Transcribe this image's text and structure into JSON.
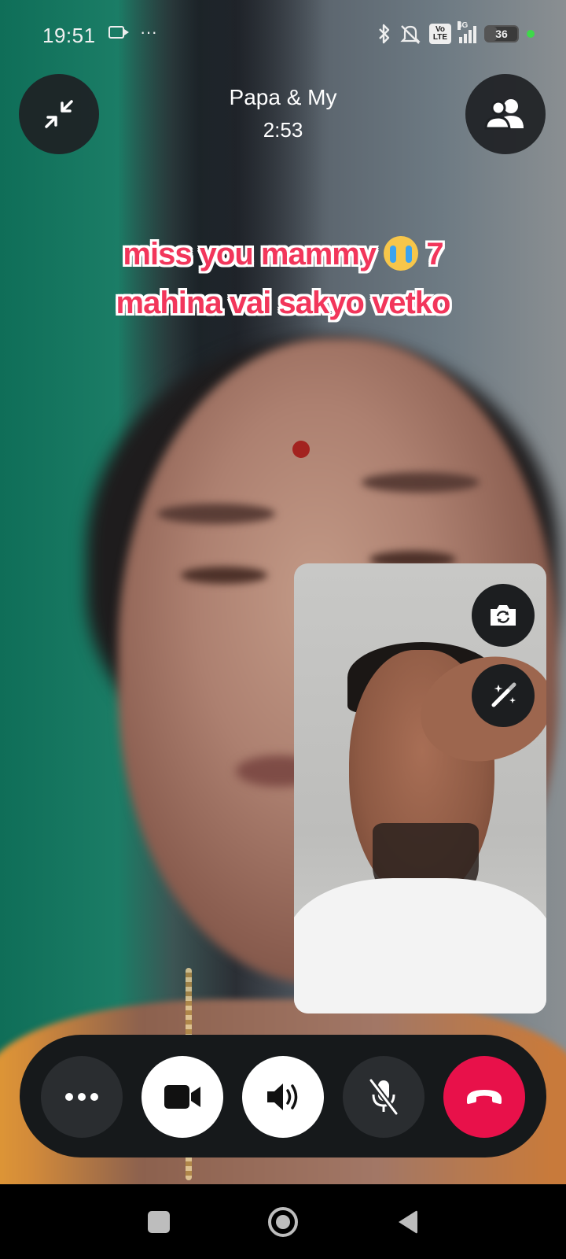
{
  "status_bar": {
    "time": "19:51",
    "left_icons": [
      "video-camera-icon",
      "more-notifications-icon"
    ],
    "overflow_glyph": "···",
    "right_icons": [
      "bluetooth-icon",
      "mute-bell-icon",
      "volte-icon",
      "signal-4g-icon",
      "battery-icon"
    ],
    "volte_label": "Vo LTE",
    "network_label": "4G",
    "battery_level": "36",
    "battery_fraction": 0.36
  },
  "call": {
    "title": "Papa & My",
    "timer": "2:53",
    "minimize_icon": "minimize-arrows-icon",
    "participants_icon": "participants-icon"
  },
  "caption": {
    "line1_before_emoji": "miss you mammy",
    "emoji": "loudly-crying-face-emoji",
    "line1_after_emoji": "7",
    "line2": "mahina vai sakyo vetko"
  },
  "self_view": {
    "flip_camera_icon": "flip-camera-icon",
    "effects_icon": "magic-wand-icon"
  },
  "controls": [
    {
      "name": "more-options",
      "icon": "more-dots-icon"
    },
    {
      "name": "video-toggle",
      "icon": "video-camera-icon"
    },
    {
      "name": "speaker-toggle",
      "icon": "speaker-icon"
    },
    {
      "name": "mute-toggle",
      "icon": "mic-off-icon"
    },
    {
      "name": "end-call",
      "icon": "hang-up-icon"
    }
  ],
  "colors": {
    "end_call": "#e8114a",
    "caption_text": "#f2365b",
    "control_bar": "#16191b"
  },
  "nav_bar": {
    "buttons": [
      "recents-square-icon",
      "home-circle-icon",
      "back-triangle-icon"
    ]
  }
}
